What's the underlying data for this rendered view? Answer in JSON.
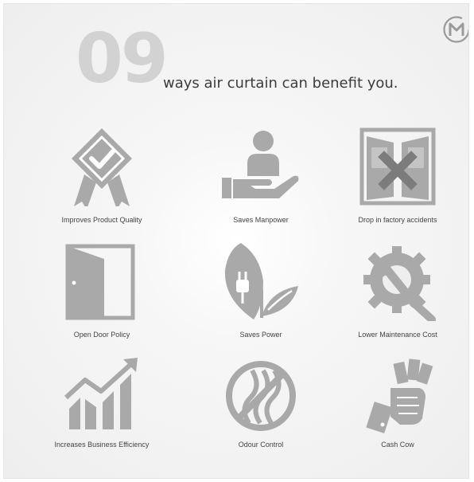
{
  "header": {
    "number": "09",
    "headline": "ways air curtain can benefit you."
  },
  "colors": {
    "icon": "#a9a9a9",
    "number": "#d2d2d2",
    "text": "#3c3c3c",
    "logo": "#9a9a9a"
  },
  "benefits": [
    {
      "label": "Improves Product Quality",
      "icon": "quality-badge-icon"
    },
    {
      "label": "Saves Manpower",
      "icon": "hand-person-icon"
    },
    {
      "label": "Drop in factory accidents",
      "icon": "door-x-icon"
    },
    {
      "label": "Open Door Policy",
      "icon": "open-door-icon"
    },
    {
      "label": "Saves Power",
      "icon": "leaf-plug-icon"
    },
    {
      "label": "Lower Maintenance Cost",
      "icon": "gear-wrench-icon"
    },
    {
      "label": "Increases Business Efficiency",
      "icon": "growth-chart-icon"
    },
    {
      "label": "Odour Control",
      "icon": "no-odour-icon"
    },
    {
      "label": "Cash Cow",
      "icon": "hand-money-icon"
    }
  ]
}
